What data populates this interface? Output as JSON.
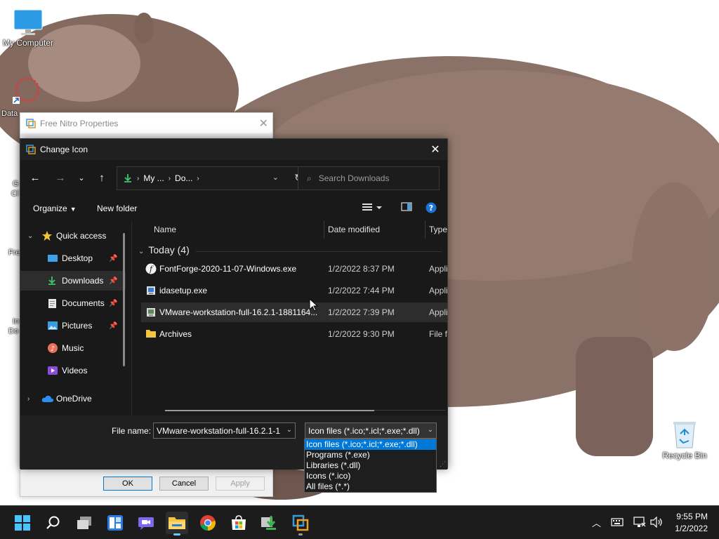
{
  "desktop": {
    "icons": {
      "my_computer": "My Computer",
      "recycle_bin": "Recycle Bin"
    },
    "edge_labels": {
      "data": "Data",
      "g": "G",
      "cl": "Cl",
      "fre": "Fre",
      "in": "In",
      "do": "Do"
    }
  },
  "props_window": {
    "title": "Free Nitro Properties",
    "ok_label": "OK",
    "cancel_label": "Cancel",
    "apply_label": "Apply"
  },
  "dialog": {
    "title": "Change Icon",
    "address": {
      "crumb1": "My ...",
      "crumb2": "Do..."
    },
    "search_placeholder": "Search Downloads",
    "toolbar": {
      "organize": "Organize",
      "new_folder": "New folder"
    },
    "nav": {
      "quick_access": "Quick access",
      "desktop": "Desktop",
      "downloads": "Downloads",
      "documents": "Documents",
      "pictures": "Pictures",
      "music": "Music",
      "videos": "Videos",
      "onedrive": "OneDrive"
    },
    "columns": {
      "name": "Name",
      "date": "Date modified",
      "type": "Type"
    },
    "group_label": "Today (4)",
    "files": [
      {
        "name": "FontForge-2020-11-07-Windows.exe",
        "date": "1/2/2022 8:37 PM",
        "type": "Appli"
      },
      {
        "name": "idasetup.exe",
        "date": "1/2/2022 7:44 PM",
        "type": "Appli"
      },
      {
        "name": "VMware-workstation-full-16.2.1-1881164...",
        "date": "1/2/2022 7:39 PM",
        "type": "Appli"
      },
      {
        "name": "Archives",
        "date": "1/2/2022 9:30 PM",
        "type": "File fo"
      }
    ],
    "filename_label": "File name:",
    "filename_value": "VMware-workstation-full-16.2.1-1",
    "filetype_selected": "Icon files (*.ico;*.icl;*.exe;*.dll)",
    "filetype_options": [
      "Icon files (*.ico;*.icl;*.exe;*.dll)",
      "Programs (*.exe)",
      "Libraries (*.dll)",
      "Icons (*.ico)",
      "All files (*.*)"
    ]
  },
  "taskbar": {
    "time": "9:55 PM",
    "date": "1/2/2022"
  },
  "colors": {
    "accent": "#0078d7",
    "dialog_bg": "#191919",
    "taskbar_bg": "#1c1c1c",
    "highlight": "#60cdff"
  }
}
